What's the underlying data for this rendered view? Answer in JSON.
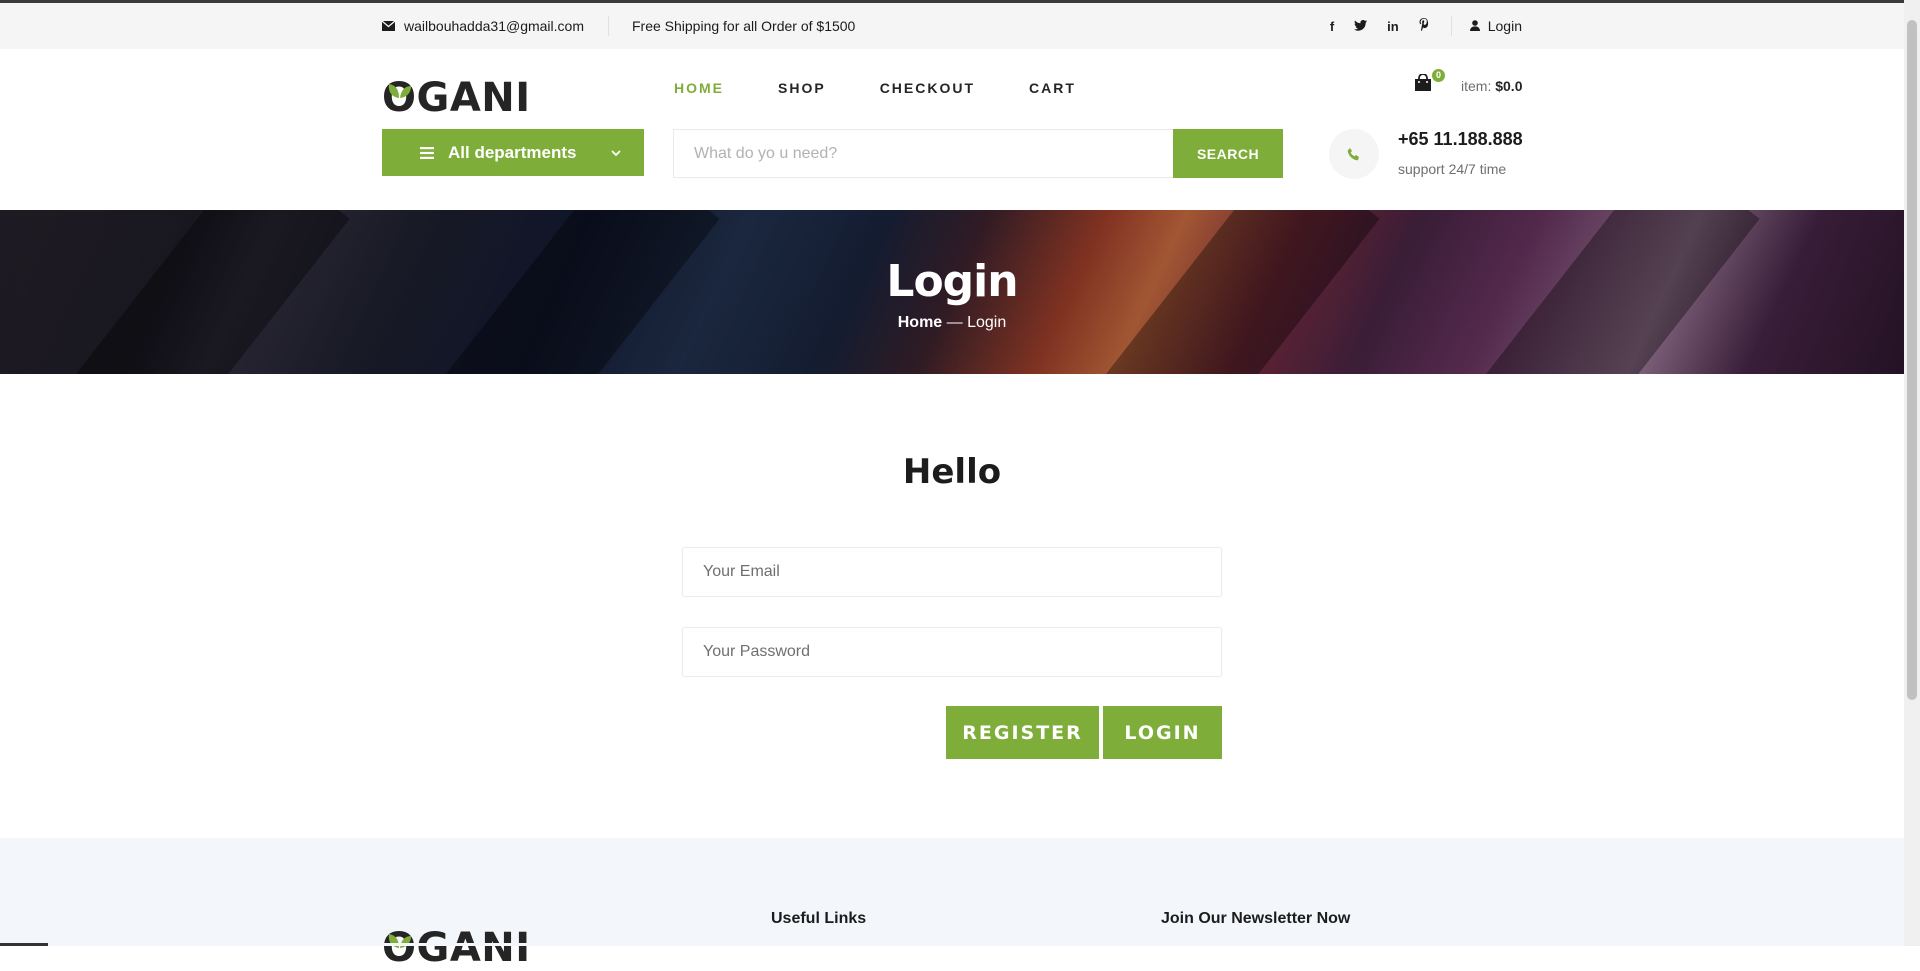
{
  "top_bar": {
    "email": "wailbouhadda31@gmail.com",
    "shipping_text": "Free Shipping for all Order of $1500",
    "social_icons": [
      "facebook-icon",
      "twitter-icon",
      "linkedin-icon",
      "pinterest-icon"
    ],
    "login_label": "Login"
  },
  "logo": {
    "text": "OGANI"
  },
  "nav": {
    "home": "HOME",
    "shop": "SHOP",
    "checkout": "CHECKOUT",
    "cart": "CART",
    "active": "HOME"
  },
  "cart": {
    "count": "0",
    "item_label": "item:",
    "total": "$0.0"
  },
  "departments": {
    "label": "All departments"
  },
  "search": {
    "placeholder": "What do yo u need?",
    "button": "SEARCH"
  },
  "support": {
    "phone": "+65 11.188.888",
    "text": "support 24/7 time"
  },
  "hero": {
    "title": "Login",
    "breadcrumb_home": "Home",
    "breadcrumb_sep": " — ",
    "breadcrumb_current": "Login"
  },
  "login_form": {
    "heading": "Hello",
    "email_placeholder": "Your Email",
    "password_placeholder": "Your Password",
    "register_label": "REGISTER",
    "login_label": "LOGIN"
  },
  "footer": {
    "logo": "OGANI",
    "useful_links": "Useful Links",
    "newsletter": "Join Our Newsletter Now"
  },
  "colors": {
    "accent": "#7fad39",
    "text": "#1c1c1c",
    "muted": "#6f6f6f",
    "footer_bg": "#f3f6fa"
  }
}
